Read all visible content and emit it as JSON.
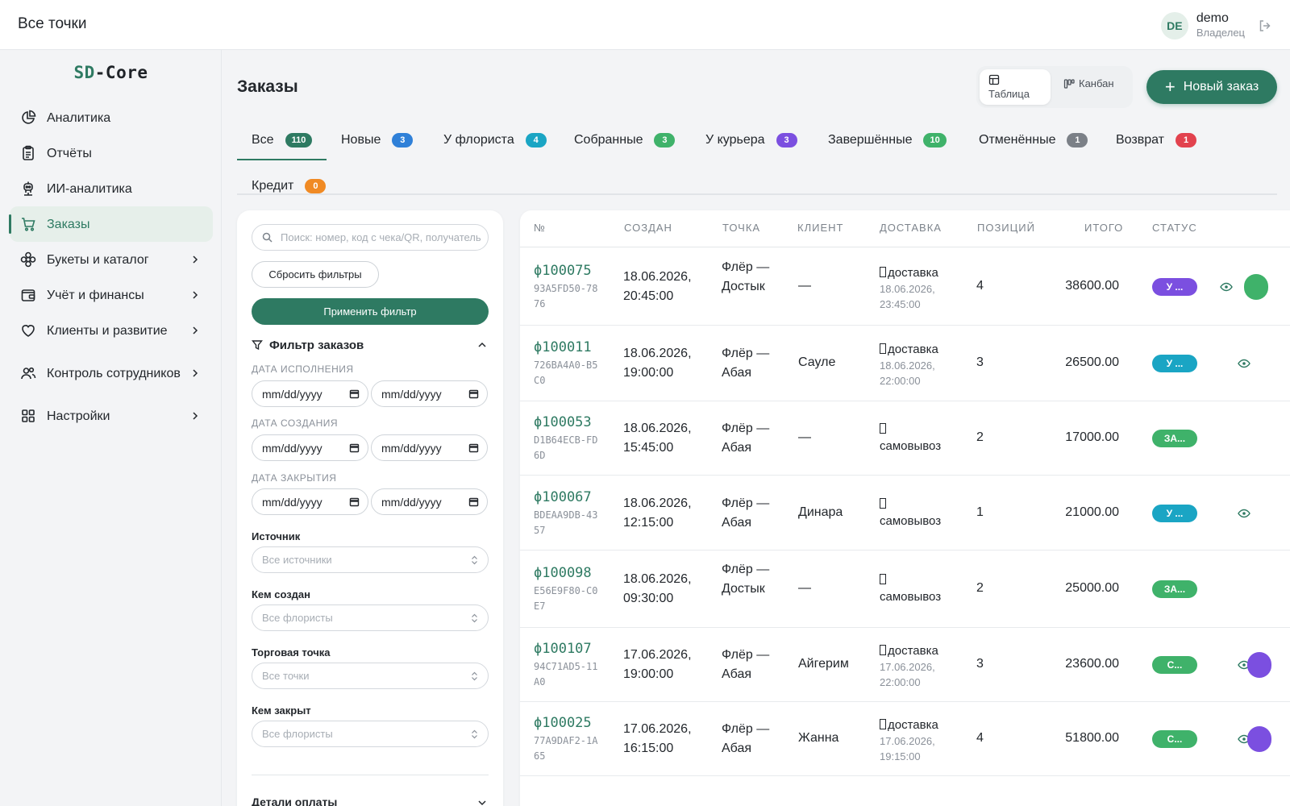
{
  "topbar": {
    "location": "Все точки",
    "user": {
      "initials": "DE",
      "name": "demo",
      "role": "Владелец"
    }
  },
  "sidebar": {
    "brand_a": "SD",
    "brand_b": "-Core",
    "items": [
      {
        "label": "Аналитика",
        "icon": "pie-chart-icon"
      },
      {
        "label": "Отчёты",
        "icon": "clipboard-icon"
      },
      {
        "label": "ИИ-аналитика",
        "icon": "robot-icon"
      },
      {
        "label": "Заказы",
        "icon": "cart-icon",
        "active": true
      },
      {
        "label": "Букеты и каталог",
        "icon": "flower-icon",
        "expandable": true
      },
      {
        "label": "Учёт и финансы",
        "icon": "wallet-icon",
        "expandable": true
      },
      {
        "label": "Клиенты и развитие",
        "icon": "heart-icon",
        "expandable": true
      },
      {
        "label": "Контроль сотрудников",
        "icon": "users-icon",
        "expandable": true
      },
      {
        "label": "Настройки",
        "icon": "grid-icon",
        "expandable": true
      }
    ]
  },
  "header": {
    "title": "Заказы",
    "view_table": "Таблица",
    "view_kanban": "Канбан",
    "new_order": "Новый заказ"
  },
  "tabs": [
    {
      "label": "Все",
      "count": "110",
      "color": "#2e7a62",
      "active": true
    },
    {
      "label": "Новые",
      "count": "3",
      "color": "#2f80d8"
    },
    {
      "label": "У флориста",
      "count": "4",
      "color": "#1aa5c4"
    },
    {
      "label": "Собранные",
      "count": "3",
      "color": "#3fb26a"
    },
    {
      "label": "У курьера",
      "count": "3",
      "color": "#7b4fe0"
    },
    {
      "label": "Завершённые",
      "count": "10",
      "color": "#3fb26a"
    },
    {
      "label": "Отменённые",
      "count": "1",
      "color": "#7b8087"
    },
    {
      "label": "Возврат",
      "count": "1",
      "color": "#e2424e"
    },
    {
      "label": "Кредит",
      "count": "0",
      "color": "#f08a24"
    }
  ],
  "filters": {
    "search_placeholder": "Поиск: номер, код с чека/QR, получатель",
    "reset": "Сбросить фильтры",
    "apply": "Применить фильтр",
    "heading": "Фильтр заказов",
    "date_exec": "ДАТА ИСПОЛНЕНИЯ",
    "date_created": "ДАТА СОЗДАНИЯ",
    "date_closed": "ДАТА ЗАКРЫТИЯ",
    "date_placeholder": "mm/dd/yyyy",
    "source_label": "Источник",
    "source_value": "Все источники",
    "creator_label": "Кем создан",
    "creator_value": "Все флористы",
    "point_label": "Торговая точка",
    "point_value": "Все точки",
    "closer_label": "Кем закрыт",
    "closer_value": "Все флористы",
    "payment_details": "Детали оплаты"
  },
  "table": {
    "columns": {
      "num": "№",
      "created": "СОЗДАН",
      "point": "ТОЧКА",
      "client": "КЛИЕНТ",
      "delivery": "ДОСТАВКА",
      "qty": "ПОЗИЦИЙ",
      "total": "ИТОГО",
      "status": "СТАТУС"
    },
    "rows": [
      {
        "id": "ϕ100075",
        "code": "93A5FD50-7876",
        "created": "18.06.2026, 20:45:00",
        "point": "Флёр — Достык",
        "client": "—",
        "delivery": "доставка",
        "delivery_date": "18.06.2026, 23:45:00",
        "qty": "4",
        "total": "38600.00",
        "status": "У ...",
        "status_color": "#7b4fe0",
        "eye": true,
        "action_color": "#3fb26a"
      },
      {
        "id": "ϕ100011",
        "code": "726BA4A0-B5C0",
        "created": "18.06.2026, 19:00:00",
        "point": "Флёр — Абая",
        "client": "Сауле",
        "delivery": "доставка",
        "delivery_date": "18.06.2026, 22:00:00",
        "qty": "3",
        "total": "26500.00",
        "status": "У ...",
        "status_color": "#1aa5c4",
        "eye": true,
        "action_color": ""
      },
      {
        "id": "ϕ100053",
        "code": "D1B64ECB-FD6D",
        "created": "18.06.2026, 15:45:00",
        "point": "Флёр — Абая",
        "client": "—",
        "delivery": "самовывоз",
        "delivery_date": "",
        "qty": "2",
        "total": "17000.00",
        "status": "ЗА...",
        "status_color": "#3fb26a",
        "eye": false,
        "action_color": ""
      },
      {
        "id": "ϕ100067",
        "code": "BDEAA9DB-4357",
        "created": "18.06.2026, 12:15:00",
        "point": "Флёр — Абая",
        "client": "Динара",
        "delivery": "самовывоз",
        "delivery_date": "",
        "qty": "1",
        "total": "21000.00",
        "status": "У ...",
        "status_color": "#1aa5c4",
        "eye": true,
        "action_color": ""
      },
      {
        "id": "ϕ100098",
        "code": "E56E9F80-C0E7",
        "created": "18.06.2026, 09:30:00",
        "point": "Флёр — Достык",
        "client": "—",
        "delivery": "самовывоз",
        "delivery_date": "",
        "qty": "2",
        "total": "25000.00",
        "status": "ЗА...",
        "status_color": "#3fb26a",
        "eye": false,
        "action_color": ""
      },
      {
        "id": "ϕ100107",
        "code": "94C71AD5-11A0",
        "created": "17.06.2026, 19:00:00",
        "point": "Флёр — Абая",
        "client": "Айгерим",
        "delivery": "доставка",
        "delivery_date": "17.06.2026, 22:00:00",
        "qty": "3",
        "total": "23600.00",
        "status": "С...",
        "status_color": "#3fb26a",
        "eye": true,
        "action_color": "#7b4fe0"
      },
      {
        "id": "ϕ100025",
        "code": "77A9DAF2-1A65",
        "created": "17.06.2026, 16:15:00",
        "point": "Флёр — Абая",
        "client": "Жанна",
        "delivery": "доставка",
        "delivery_date": "17.06.2026, 19:15:00",
        "qty": "4",
        "total": "51800.00",
        "status": "С...",
        "status_color": "#3fb26a",
        "eye": true,
        "action_color": "#7b4fe0"
      }
    ]
  }
}
